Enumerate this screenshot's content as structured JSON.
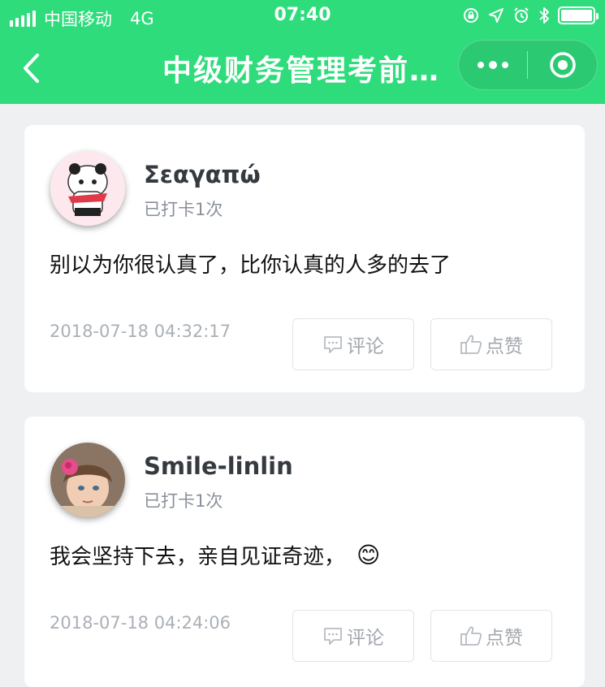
{
  "status_bar": {
    "carrier": "中国移动",
    "network": "4G",
    "time": "07:40",
    "battery_level": 1.0
  },
  "nav": {
    "title": "中级财务管理考前…",
    "back_icon": "chevron-left-icon",
    "more_icon": "more-dots-icon",
    "close_icon": "target-close-icon"
  },
  "posts": [
    {
      "username": "Σεαγαπώ",
      "checkin": "已打卡1次",
      "content": "别以为你很认真了，比你认真的人多的去了",
      "timestamp": "2018-07-18 04:32:17",
      "comment_label": "评论",
      "like_label": "点赞"
    },
    {
      "username": "Smile-linlin",
      "checkin": "已打卡1次",
      "content": "我会坚持下去，亲自见证奇迹，",
      "emoji": "😊",
      "timestamp": "2018-07-18 04:24:06",
      "comment_label": "评论",
      "like_label": "点赞"
    }
  ],
  "colors": {
    "header_green": "#2fdc7c",
    "page_bg": "#eef0f2",
    "muted_text": "#aab0b7"
  }
}
